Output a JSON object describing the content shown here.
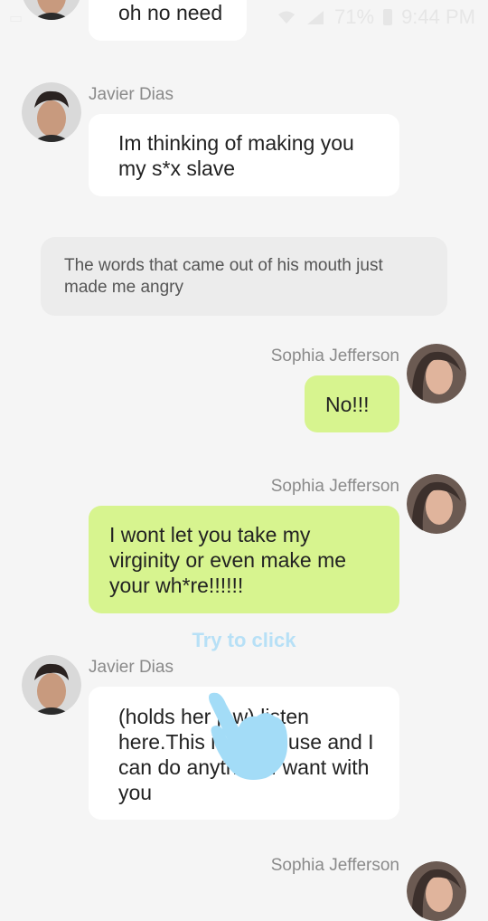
{
  "status_bar": {
    "battery": "71%",
    "time": "9:44 PM"
  },
  "messages": [
    {
      "text": "oh no need"
    },
    {
      "sender": "Javier Dias",
      "text": "Im thinking of making you my s*x slave"
    },
    {
      "narration": "The words that came out of his mouth just made me angry"
    },
    {
      "sender": "Sophia Jefferson",
      "text": "No!!!"
    },
    {
      "sender": "Sophia Jefferson",
      "text": "I wont let you take my virginity or even make me your wh*re!!!!!!"
    },
    {
      "sender": "Javier Dias",
      "text": "(holds her jaw) listen here.This is my house and I can do anything I want with you"
    },
    {
      "sender": "Sophia Jefferson"
    }
  ],
  "hint": "Try to click",
  "icons": {
    "javier_avatar": "javier-avatar",
    "sophia_avatar": "sophia-avatar",
    "tap_hand": "hand-pointer-icon"
  },
  "colors": {
    "background": "#f5f5f5",
    "white_bubble": "#ffffff",
    "green_bubble": "#d7f48f",
    "narration_bg": "#ececec",
    "hint": "#b7e0f6",
    "hand": "#a3dcf7"
  }
}
